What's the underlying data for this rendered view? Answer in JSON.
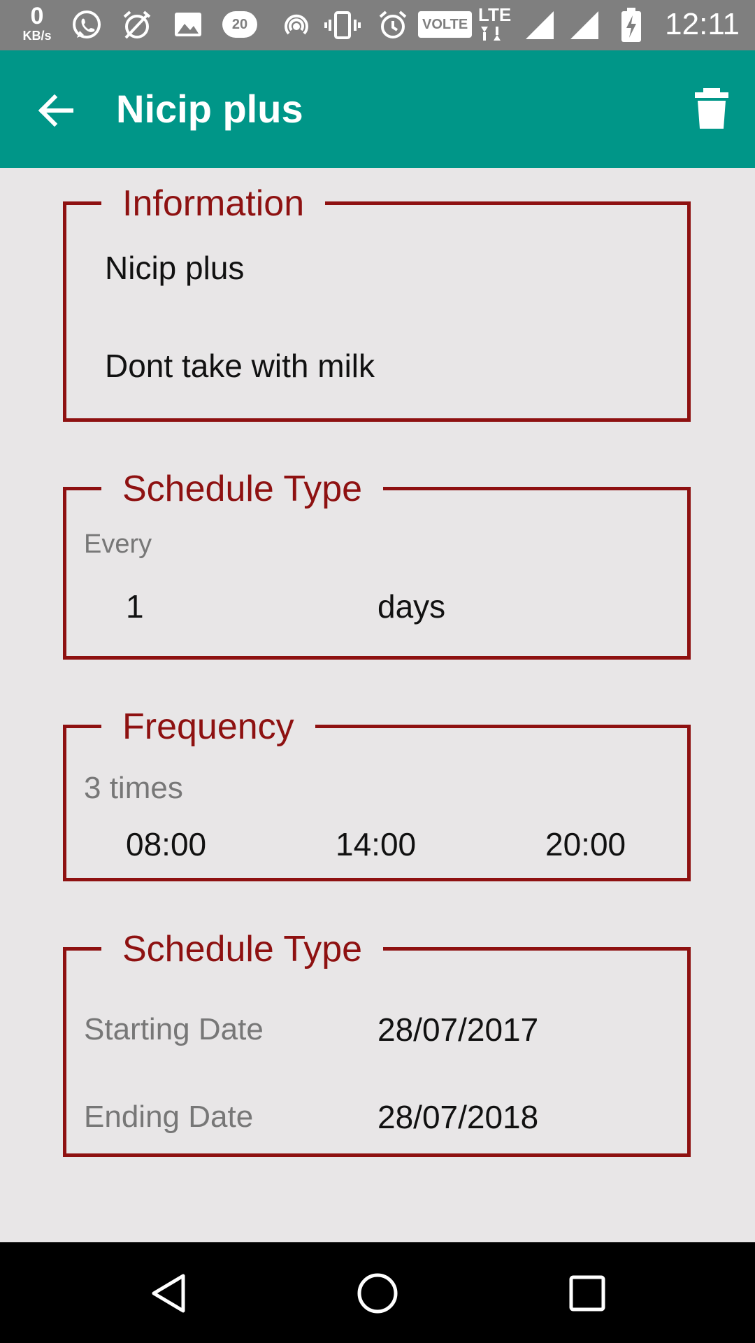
{
  "status_bar": {
    "net_speed_value": "0",
    "net_speed_unit": "KB/s",
    "badge_20": "20",
    "volte": "VOLTE",
    "lte": "LTE",
    "time": "12:11",
    "icons": [
      "whatsapp-icon",
      "alarm-off-icon",
      "image-icon",
      "data-saver-icon",
      "hotspot-icon",
      "vibrate-icon",
      "alarm-icon",
      "signal-icon",
      "battery-charging-icon"
    ]
  },
  "app_bar": {
    "title": "Nicip plus",
    "back_icon": "arrow-back-icon",
    "delete_icon": "delete-icon",
    "color": "#009688"
  },
  "information": {
    "legend": "Information",
    "name": "Nicip plus",
    "note": "Dont take with milk"
  },
  "schedule_type": {
    "legend": "Schedule Type",
    "every_label": "Every",
    "count": "1",
    "unit": "days"
  },
  "frequency": {
    "legend": "Frequency",
    "times_label": "3 times",
    "times": [
      "08:00",
      "14:00",
      "20:00"
    ]
  },
  "dates": {
    "legend": "Schedule Type",
    "start_label": "Starting Date",
    "start_value": "28/07/2017",
    "end_label": "Ending Date",
    "end_value": "28/07/2018"
  },
  "colors": {
    "accent": "#8e1111",
    "background": "#e8e6e7"
  }
}
